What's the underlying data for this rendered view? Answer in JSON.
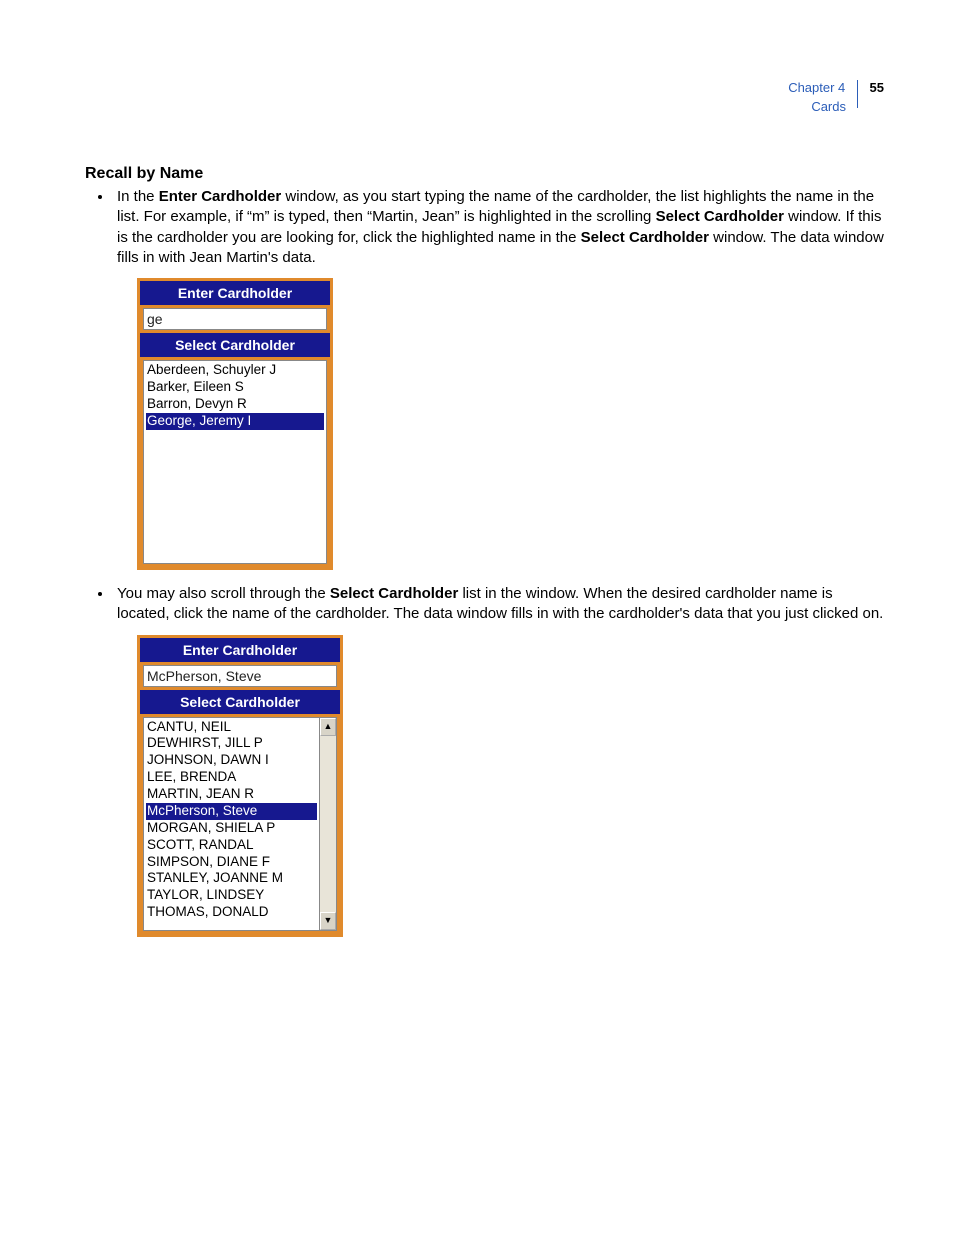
{
  "header": {
    "chapter": "Chapter 4",
    "section": "Cards",
    "page": "55"
  },
  "heading": "Recall by Name",
  "para1": {
    "t1": "In the ",
    "b1": "Enter Cardholder",
    "t2": " window, as you start typing the name of the cardholder, the list highlights the name in the list. For example, if “m” is typed, then “Martin, Jean” is highlighted in the scrolling ",
    "b2": "Select Cardholder",
    "t3": " window. If this is the cardholder you are looking for, click the highlighted name in the ",
    "b3": "Select Cardholder",
    "t4": " window. The data window fills in with Jean Martin's data."
  },
  "widget1": {
    "enterTitle": "Enter Cardholder",
    "enterValue": "ge",
    "selectTitle": "Select Cardholder",
    "list": [
      "Aberdeen, Schuyler J",
      "Barker, Eileen S",
      "Barron, Devyn R",
      "George, Jeremy I"
    ],
    "selectedIndex": 3
  },
  "para2": {
    "t1": "You may also scroll through the ",
    "b1": "Select Cardholder",
    "t2": " list in the window. When the desired cardholder name is located, click the name of the cardholder. The data window fills in with the cardholder's data that you just clicked on."
  },
  "widget2": {
    "enterTitle": "Enter Cardholder",
    "enterValue": "McPherson, Steve",
    "selectTitle": "Select Cardholder",
    "list": [
      "CANTU, NEIL",
      "DEWHIRST, JILL P",
      "JOHNSON, DAWN I",
      "LEE, BRENDA",
      "MARTIN, JEAN R",
      "McPherson, Steve",
      "MORGAN, SHIELA P",
      "SCOTT, RANDAL",
      "SIMPSON, DIANE F",
      "STANLEY, JOANNE M",
      "TAYLOR, LINDSEY",
      "THOMAS, DONALD"
    ],
    "selectedIndex": 5,
    "upGlyph": "▲",
    "downGlyph": "▼"
  }
}
